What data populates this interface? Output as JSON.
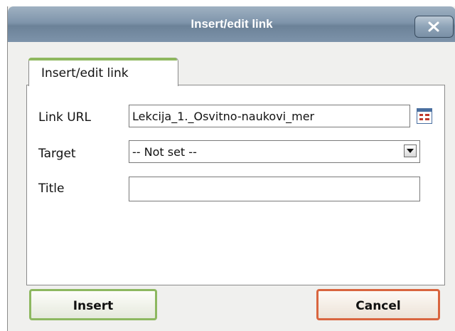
{
  "window": {
    "title": "Insert/edit link"
  },
  "tabs": [
    {
      "label": "Insert/edit link"
    }
  ],
  "form": {
    "link_url_label": "Link URL",
    "link_url_value": "Lekcija_1._Osvitno-naukovi_mer",
    "target_label": "Target",
    "target_value": "-- Not set --",
    "title_label": "Title",
    "title_value": ""
  },
  "buttons": {
    "insert": "Insert",
    "cancel": "Cancel"
  },
  "colors": {
    "titlebar": "#7f95ab",
    "insert_border": "#8db860",
    "cancel_border": "#d9653f",
    "tab_accent": "#8fb85f"
  },
  "icons": {
    "close": "close-icon",
    "browse": "browse-icon",
    "dropdown": "chevron-down-icon"
  }
}
